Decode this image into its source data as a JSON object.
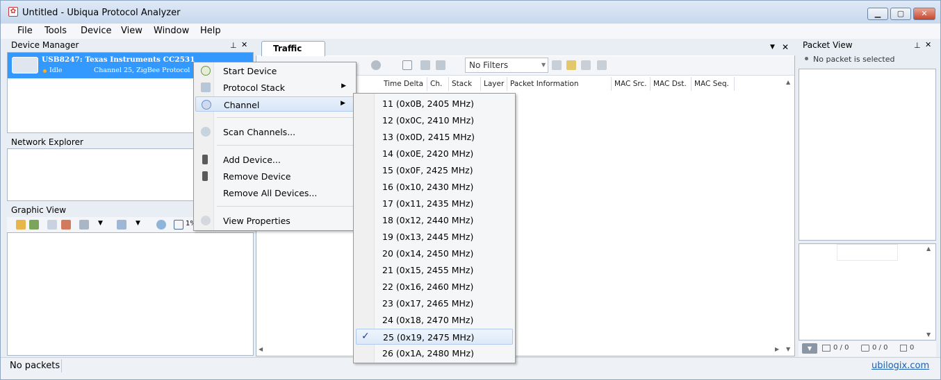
{
  "window": {
    "title": "Untitled - Ubiqua Protocol Analyzer",
    "controls": {
      "minimize": "▁",
      "maximize": "▢",
      "close": "✕"
    }
  },
  "menu": [
    "File",
    "Tools",
    "Device",
    "View",
    "Window",
    "Help"
  ],
  "device_manager": {
    "title": "Device Manager",
    "device": {
      "name": "USB8247: Texas Instruments CC2531",
      "status": "Idle",
      "detail": "Channel 25, ZigBee Protocol"
    }
  },
  "network_explorer": {
    "title": "Network Explorer"
  },
  "graphic_view": {
    "title": "Graphic View",
    "zoom": "1%"
  },
  "traffic_view": {
    "tab": "Traffic View",
    "filter": "No Filters",
    "columns": [
      "Time Delta",
      "Ch.",
      "Stack",
      "Layer",
      "Packet Information",
      "MAC Src.",
      "MAC Dst.",
      "MAC Seq."
    ]
  },
  "packet_view": {
    "title": "Packet View",
    "empty_msg": "No packet is selected",
    "footer": {
      "a": "0 / 0",
      "b": "0 / 0",
      "c": "0"
    }
  },
  "context_menu": {
    "items": [
      {
        "label": "Start Device",
        "icon": "play-icon"
      },
      {
        "label": "Protocol Stack",
        "icon": "stack-icon",
        "submenu": true
      },
      {
        "label": "Channel",
        "icon": "channel-icon",
        "submenu": true,
        "highlight": true
      },
      {
        "label": "Scan Channels...",
        "icon": "scan-icon"
      },
      {
        "label": "Add Device...",
        "icon": "add-device-icon"
      },
      {
        "label": "Remove Device",
        "icon": "remove-device-icon"
      },
      {
        "label": "Remove All Devices...",
        "icon": ""
      },
      {
        "label": "View Properties",
        "icon": "properties-icon"
      }
    ]
  },
  "channel_menu": {
    "items": [
      "11 (0x0B, 2405 MHz)",
      "12 (0x0C, 2410 MHz)",
      "13 (0x0D, 2415 MHz)",
      "14 (0x0E, 2420 MHz)",
      "15 (0x0F, 2425 MHz)",
      "16 (0x10, 2430 MHz)",
      "17 (0x11, 2435 MHz)",
      "18 (0x12, 2440 MHz)",
      "19 (0x13, 2445 MHz)",
      "20 (0x14, 2450 MHz)",
      "21 (0x15, 2455 MHz)",
      "22 (0x16, 2460 MHz)",
      "23 (0x17, 2465 MHz)",
      "24 (0x18, 2470 MHz)",
      "25 (0x19, 2475 MHz)",
      "26 (0x1A, 2480 MHz)"
    ],
    "selected": "25 (0x19, 2475 MHz)"
  },
  "status": {
    "packets": "No packets",
    "link": "ubilogix.com"
  },
  "colors": {
    "selection": "#3399ff",
    "accent": "#1a5fb4"
  }
}
